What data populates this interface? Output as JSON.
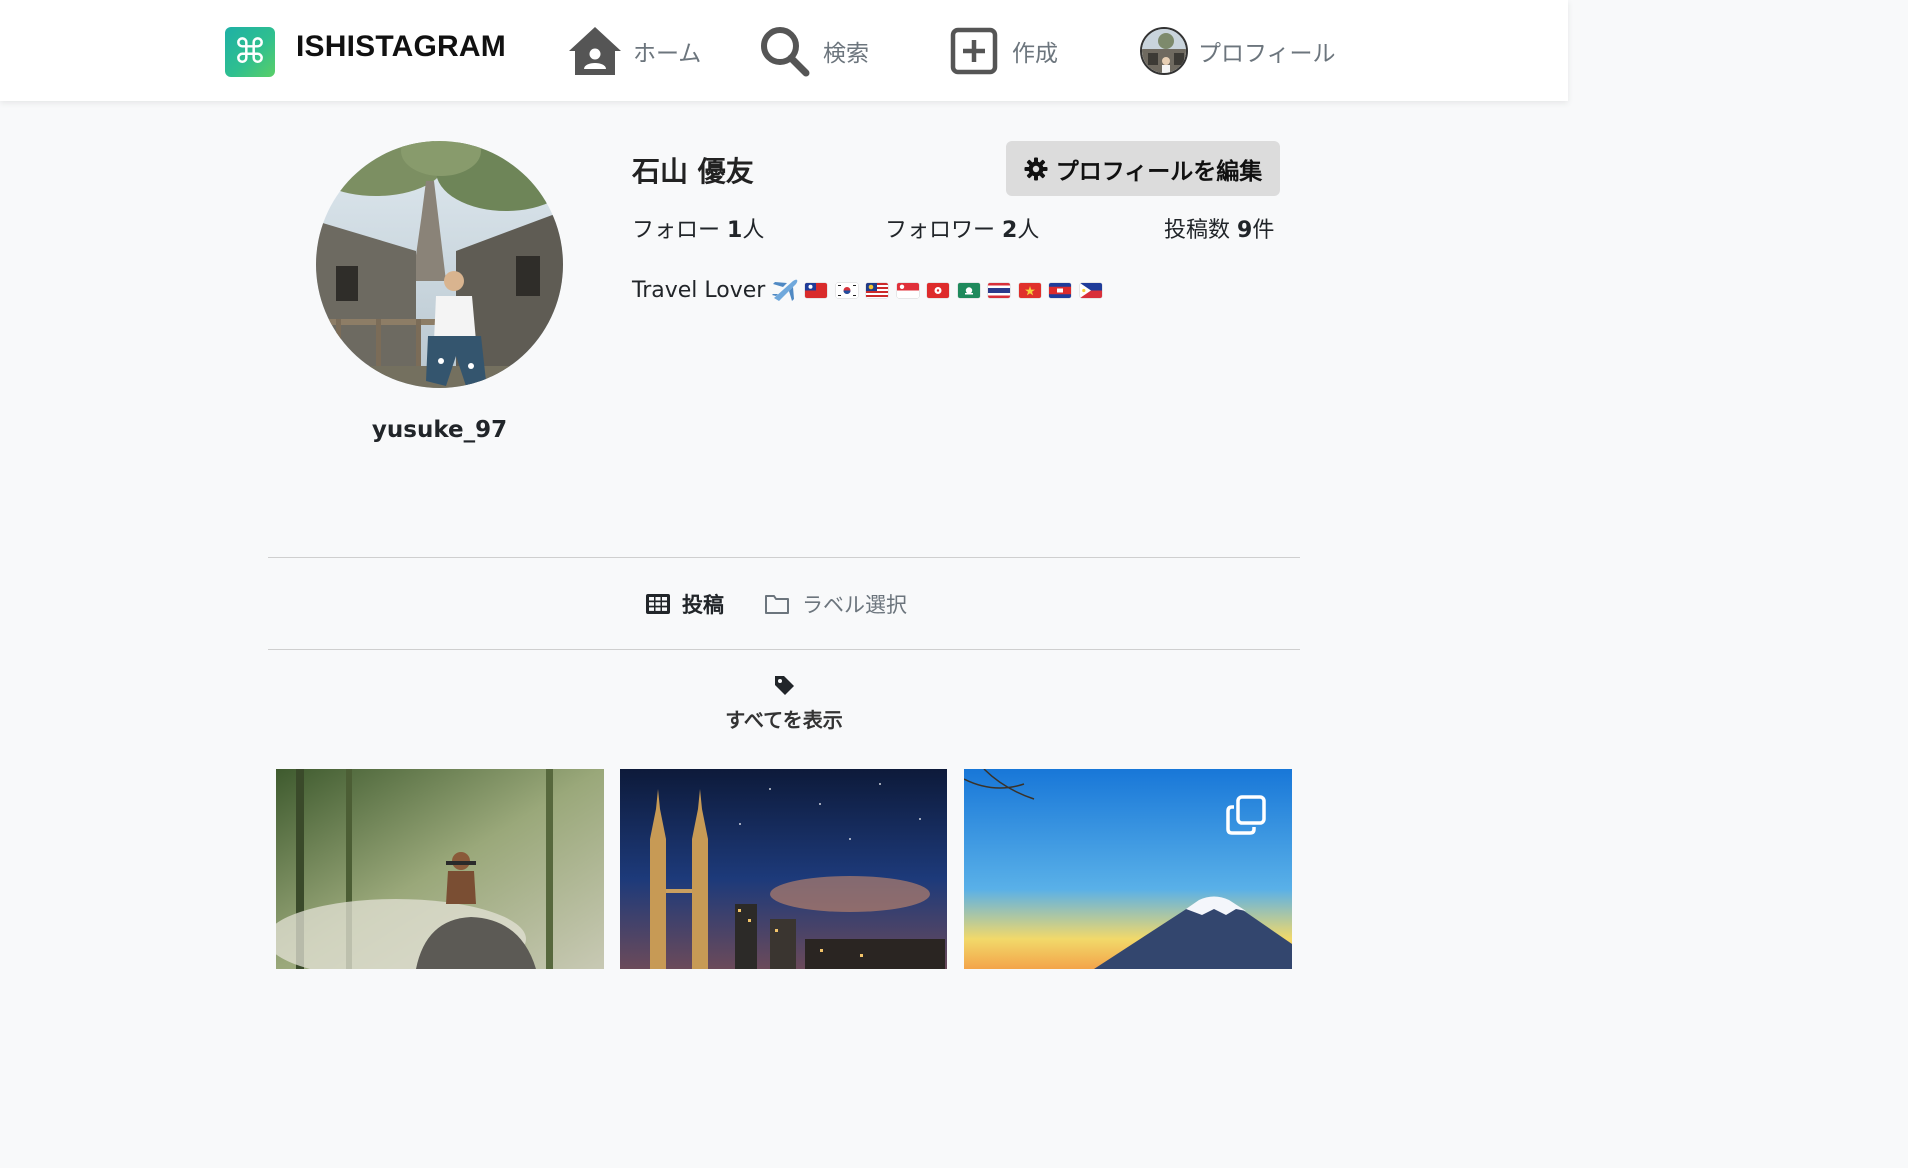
{
  "brand": {
    "name": "ISHISTAGRAM",
    "logo_glyph": "⌘"
  },
  "nav": {
    "home": "ホーム",
    "search": "検索",
    "create": "作成",
    "profile": "プロフィール"
  },
  "profile": {
    "display_name": "石山 優友",
    "username": "yusuke_97",
    "edit_button": "プロフィールを編集",
    "stats": {
      "following_label": "フォロー",
      "following_count": "1",
      "following_unit": "人",
      "followers_label": "フォロワー",
      "followers_count": "2",
      "followers_unit": "人",
      "posts_label": "投稿数",
      "posts_count": "9",
      "posts_unit": "件"
    },
    "bio": "Travel Lover",
    "bio_flags": [
      "taiwan",
      "south-korea",
      "malaysia",
      "singapore",
      "hong-kong",
      "macau",
      "thailand",
      "vietnam",
      "cambodia",
      "philippines"
    ]
  },
  "tabs": {
    "posts": "投稿",
    "labels": "ラベル選択"
  },
  "label_filter": {
    "text": "すべてを表示"
  },
  "colors": {
    "accent": "#2fbf8f",
    "button_bg": "#dcdcdc",
    "page_bg": "#f8f9fa"
  }
}
